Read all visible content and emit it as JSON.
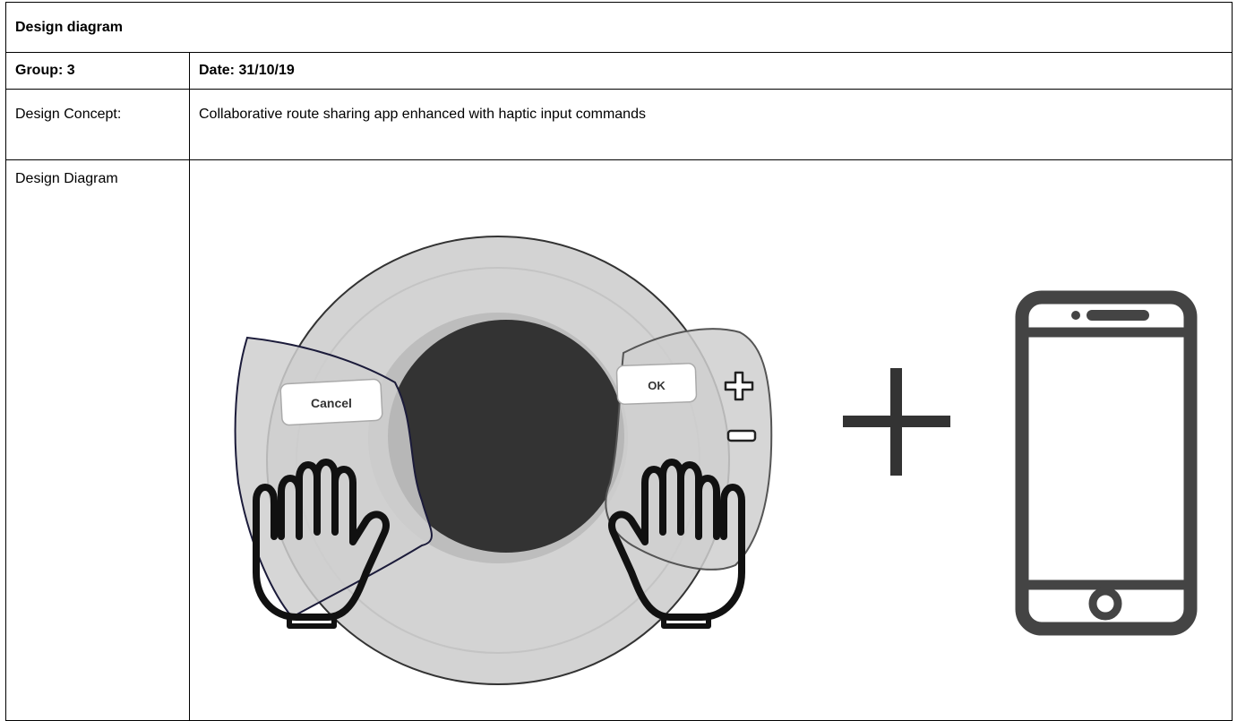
{
  "form": {
    "title": "Design diagram",
    "group_label": "Group: 3",
    "date_label": "Date: 31/10/19",
    "concept_label": "Design Concept:",
    "concept_text": "Collaborative route sharing app enhanced with haptic input commands",
    "diagram_label": "Design Diagram"
  },
  "diagram": {
    "cancel_button": "Cancel",
    "ok_button": "OK",
    "icons": [
      "steering-wheel-icon",
      "hand-icon",
      "plus-icon",
      "minus-icon",
      "smartphone-icon"
    ],
    "colors": {
      "wheel": "#d3d3d3",
      "hub": "#333333",
      "outline": "#222222",
      "phone": "#444444"
    }
  }
}
